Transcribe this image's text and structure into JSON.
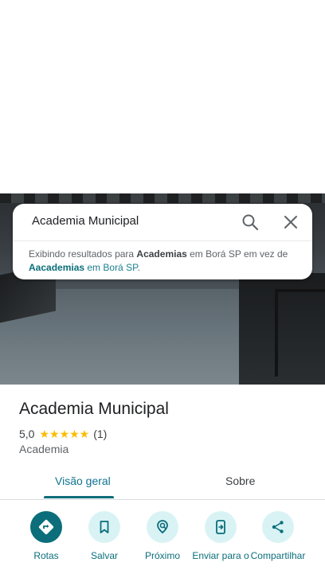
{
  "search": {
    "query": "Academia Municipal",
    "hint_prefix": "Exibindo resultados para ",
    "hint_term": "Academias",
    "hint_middle": " em Borá SP em vez de ",
    "hint_alt_term": "Aacademias",
    "hint_alt_suffix": " em Borá SP",
    "hint_end": "."
  },
  "place": {
    "title": "Academia Municipal",
    "rating": "5,0",
    "stars": "★★★★★",
    "review_count": "(1)",
    "category": "Academia"
  },
  "tabs": [
    {
      "label": "Visão geral",
      "active": true
    },
    {
      "label": "Sobre",
      "active": false
    }
  ],
  "actions": [
    {
      "label": "Rotas",
      "icon": "directions-icon"
    },
    {
      "label": "Salvar",
      "icon": "bookmark-icon"
    },
    {
      "label": "Próximo",
      "icon": "nearby-icon"
    },
    {
      "label": "Enviar para o",
      "icon": "send-to-phone-icon"
    },
    {
      "label": "Compartilhar",
      "icon": "share-icon"
    }
  ],
  "colors": {
    "accent": "#0b6e7a",
    "accent_light": "#d9f3f5",
    "star": "#fbbc04"
  }
}
